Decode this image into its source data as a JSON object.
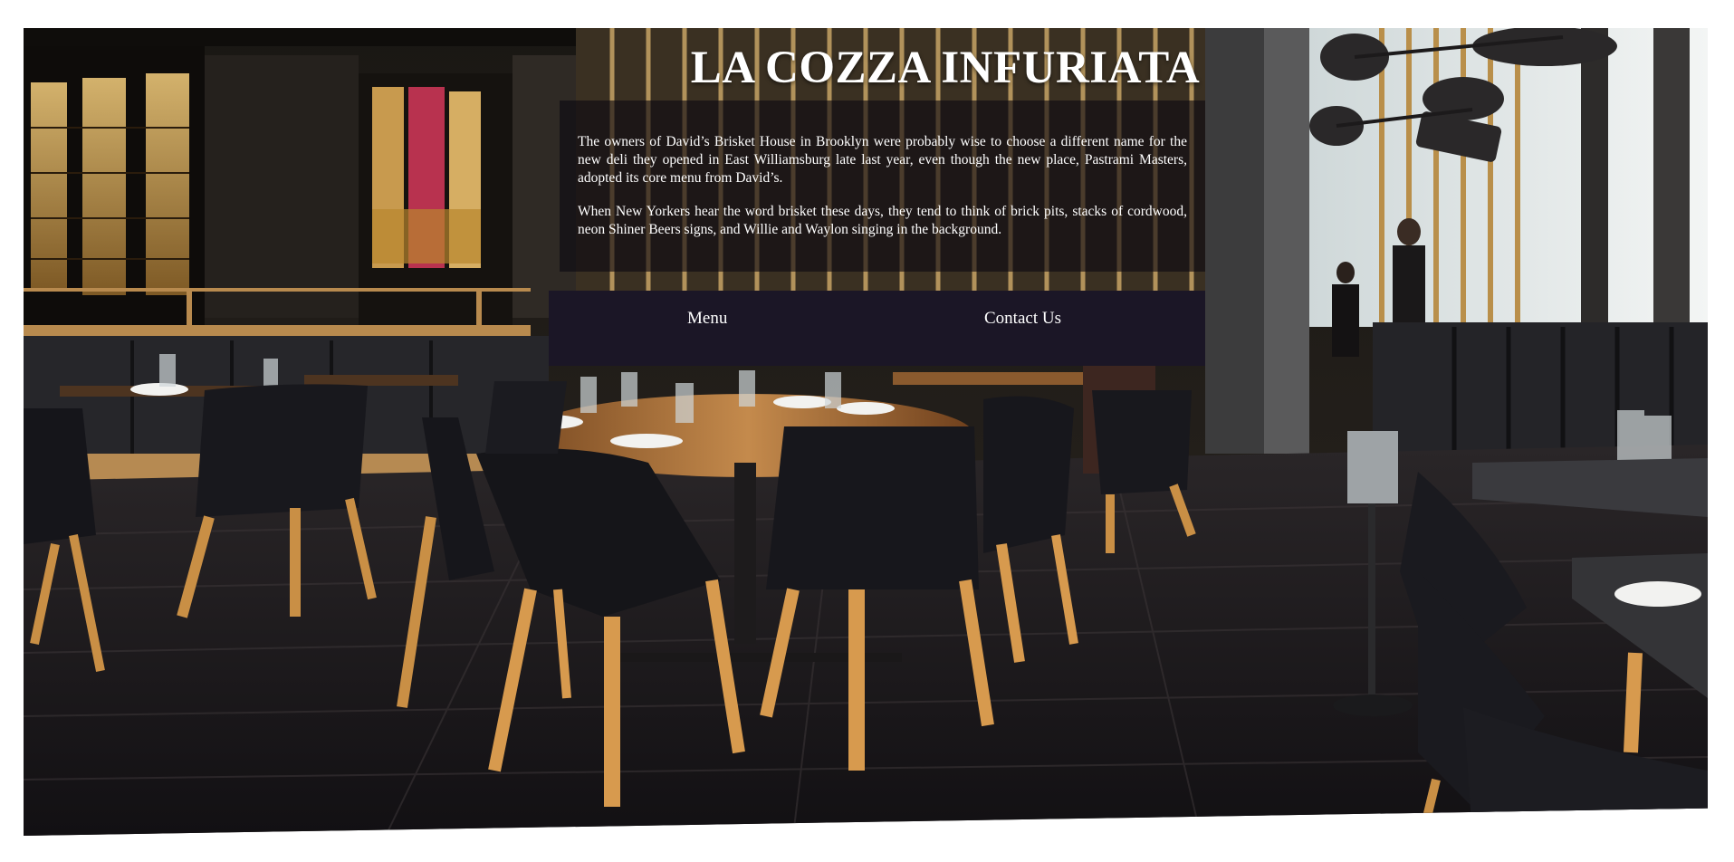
{
  "site": {
    "title": "LA COZZA INFURIATA"
  },
  "intro": {
    "paragraphs": [
      "The owners of David’s Brisket House in Brooklyn were probably wise to choose a different name for the new deli they opened in East Williamsburg late last year, even though the new place, Pastrami Masters, adopted its core menu from David’s.",
      "When New Yorkers hear the word brisket these days, they tend to think of brick pits, stacks of cordwood, neon Shiner Beers signs, and Willie and Waylon singing in the background."
    ]
  },
  "nav": {
    "items": [
      {
        "label": "Menu"
      },
      {
        "label": "Contact Us"
      }
    ]
  },
  "colors": {
    "nav_background": "#1b1626",
    "panel_background": "rgba(12, 8, 16, 0.62)",
    "text": "#ffffff"
  }
}
